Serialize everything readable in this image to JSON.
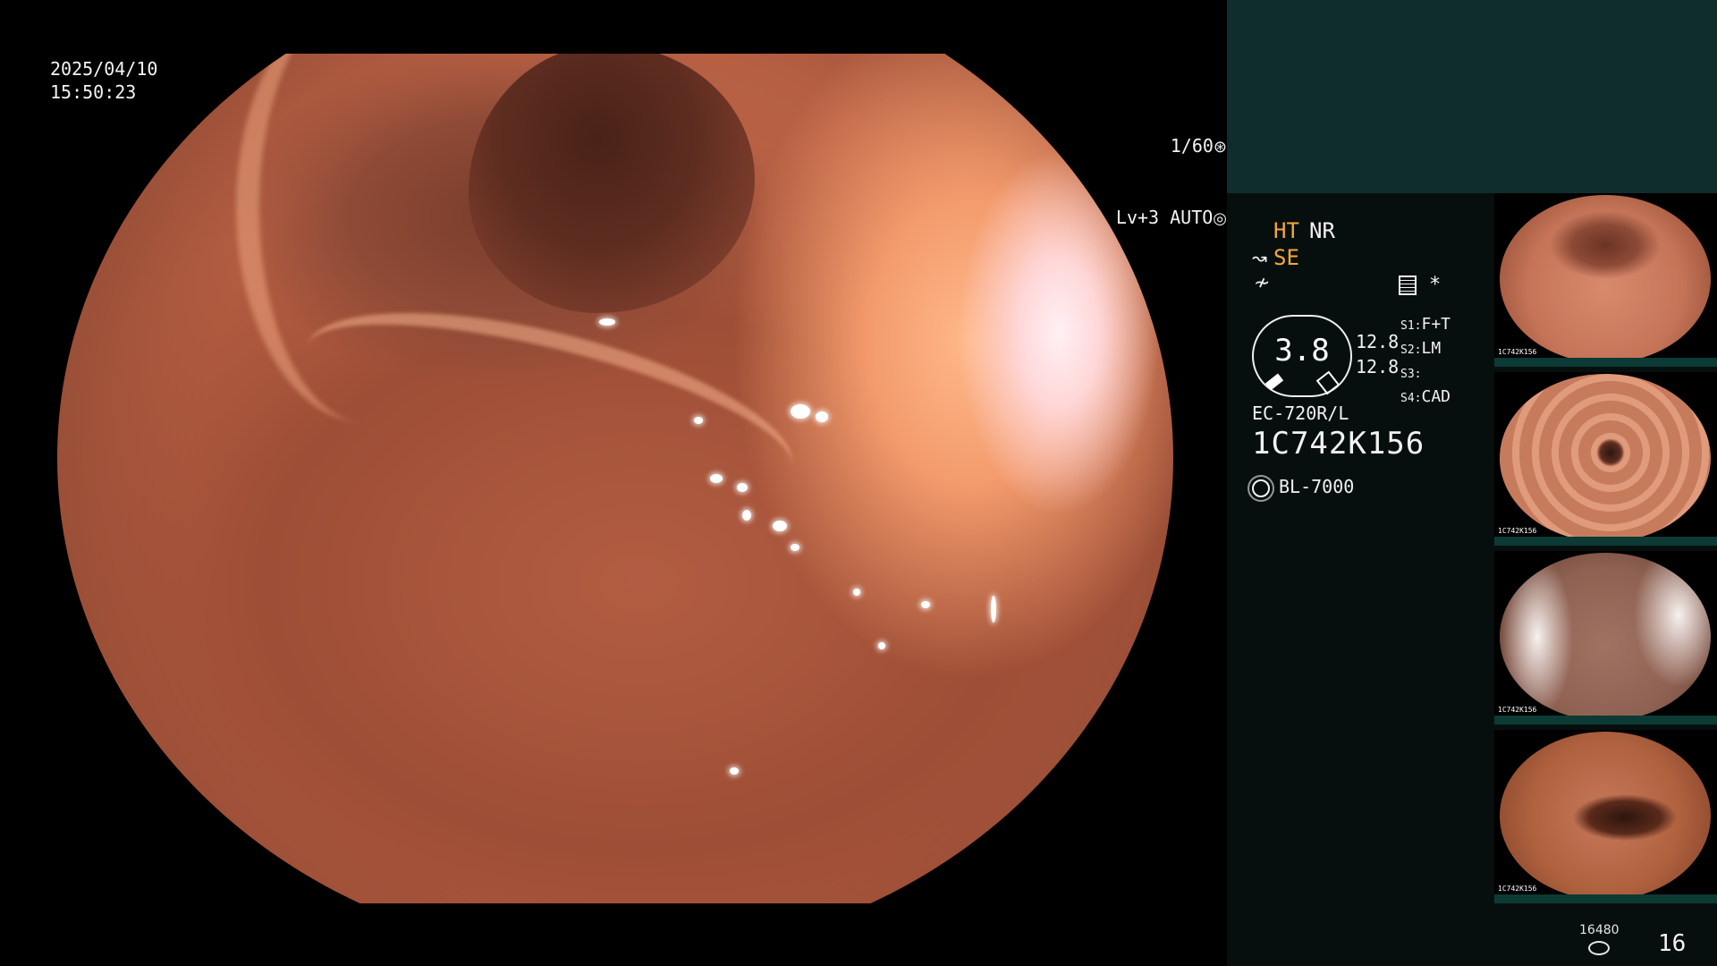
{
  "overlay": {
    "date": "2025/04/10",
    "time": "15:50:23",
    "shutter": "1/60",
    "iris": "Lv+3 AUTO"
  },
  "panel": {
    "ht": "HT",
    "nr": "NR",
    "se": "SE",
    "gauge_value": "3.8",
    "stat_1": "12.8",
    "stat_2": "12.8",
    "switches": [
      {
        "key": "S1",
        "value": "F+T"
      },
      {
        "key": "S2",
        "value": "LM"
      },
      {
        "key": "S3",
        "value": ""
      },
      {
        "key": "S4",
        "value": "CAD"
      }
    ],
    "scope_model": "EC-720R/L",
    "scope_serial": "1C742K156",
    "light_source": "BL-7000",
    "asterisk": "*"
  },
  "thumbnails": [
    {
      "serial": "1C742K156",
      "name": "thumb-1"
    },
    {
      "serial": "1C742K156",
      "name": "thumb-2"
    },
    {
      "serial": "1C742K156",
      "name": "thumb-3"
    },
    {
      "serial": "1C742K156",
      "name": "thumb-4"
    }
  ],
  "footer": {
    "storage_count": "16480",
    "image_count": "16"
  },
  "colors": {
    "accent_orange": "#f4a836",
    "panel_top": "#0f2d2c",
    "panel_body": "#070f0e"
  }
}
